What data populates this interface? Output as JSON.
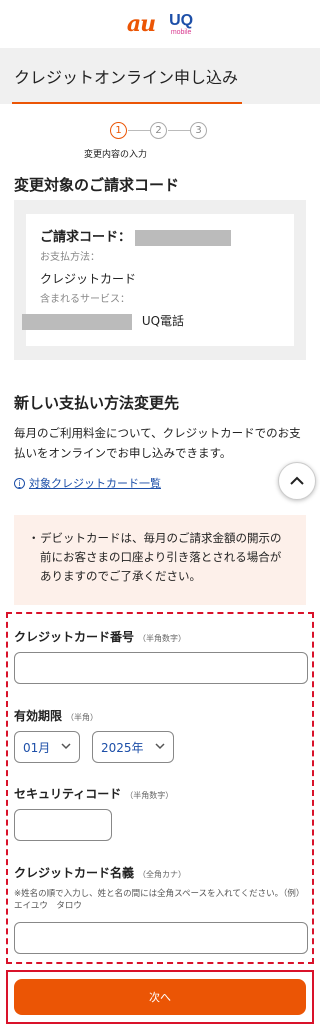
{
  "header": {
    "logo_au": "au",
    "logo_uq": "UQ",
    "logo_uq_sub": "mobile"
  },
  "page_title": "クレジットオンライン申し込み",
  "steps": {
    "items": [
      "1",
      "2",
      "3"
    ],
    "current_label": "変更内容の入力"
  },
  "billing": {
    "section_title": "変更対象のご請求コード",
    "code_label": "ご請求コード：",
    "payment_method_label": "お支払方法：",
    "payment_method_value": "クレジットカード",
    "services_label": "含まれるサービス：",
    "service_value": "UQ電話"
  },
  "new_payment": {
    "section_title": "新しい支払い方法変更先",
    "description": "毎月のご利用料金について、クレジットカードでのお支払いをオンラインでお申し込みできます。",
    "cards_link": "対象クレジットカード一覧"
  },
  "notice": {
    "bullet": "・",
    "text": "デビットカードは、毎月のご請求金額の開示の前にお客さまの口座より引き落とされる場合がありますのでご了承ください。"
  },
  "form": {
    "card_number_label": "クレジットカード番号",
    "card_number_hint": "（半角数字）",
    "card_number_value": "",
    "expiry_label": "有効期限",
    "expiry_hint": "（半角）",
    "expiry_month": "01月",
    "expiry_year": "2025年",
    "security_label": "セキュリティコード",
    "security_hint": "（半角数字）",
    "security_value": "",
    "name_label": "クレジットカード名義",
    "name_hint": "（全角カナ）",
    "name_note": "※姓名の順で入力し、姓と名の間には全角スペースを入れてください。（例）エイユウ　タロウ",
    "name_value": ""
  },
  "next_button": "次へ",
  "colors": {
    "accent": "#eb5505",
    "highlight_border": "#d9122a",
    "link": "#1d4fa8",
    "notice_bg": "#fdf0ea"
  },
  "icons": {
    "info": "info-icon",
    "scroll_top": "chevron-up-icon",
    "select": "chevron-down-icon"
  }
}
